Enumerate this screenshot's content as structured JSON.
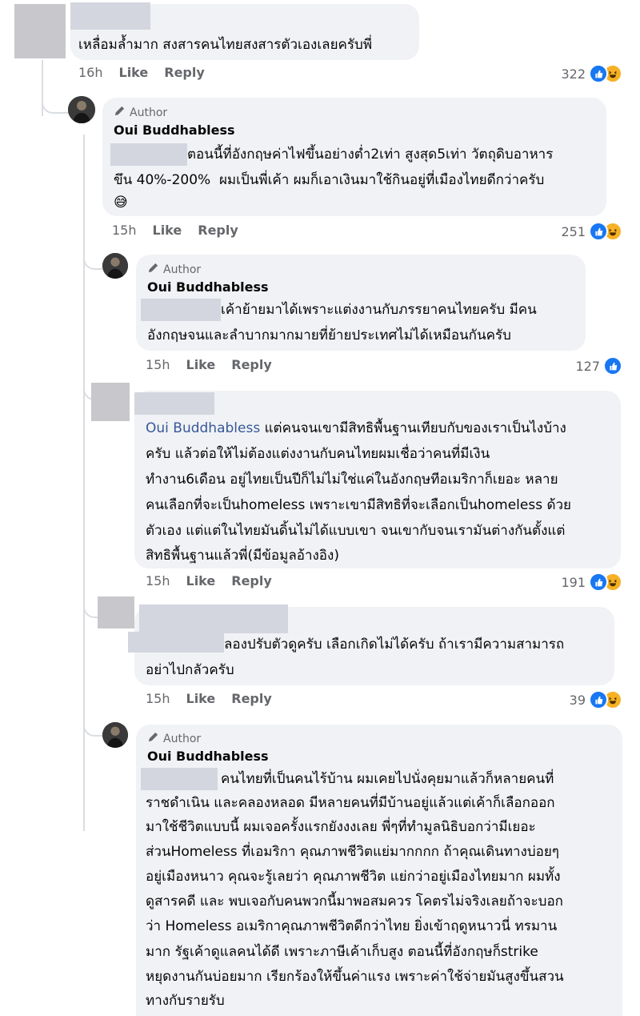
{
  "actions": {
    "like": "Like",
    "reply": "Reply"
  },
  "comments": [
    {
      "id": "c1",
      "text": [
        "เหลื่อมล้ำมาก สงสารคนไทยสงสารตัวเองเลยครับพี่"
      ],
      "time": "16h",
      "reactions": "322",
      "icons": [
        "like-icon",
        "haha-icon"
      ]
    },
    {
      "id": "c2",
      "badge": "Author",
      "name": "Oui Buddhabless",
      "text": [
        "ตอนนี้ที่อังกฤษค่าไฟขึ้นอย่างต่ำ2เท่า สูงสุด5เท่า วัตถุดิบอาหาร",
        "ขึน 40%-200%  ผมเป็นพี่เค้า ผมก็เอาเงินมาใช้กินอยู่ที่เมืองไทยดีกว่าครับ",
        "😅"
      ],
      "time": "15h",
      "reactions": "251",
      "icons": [
        "like-icon",
        "haha-icon"
      ]
    },
    {
      "id": "c3",
      "badge": "Author",
      "name": "Oui Buddhabless",
      "text": [
        "เค้าย้ายมาได้เพราะแต่งงานกับภรรยาคนไทยครับ มีคน",
        "อังกฤษจนและลำบากมากมายที่ย้ายประเทศไม่ได้เหมือนกันครับ"
      ],
      "time": "15h",
      "reactions": "127",
      "icons": [
        "like-icon"
      ]
    },
    {
      "id": "c4",
      "mention": "Oui Buddhabless",
      "text": [
        " แต่คนจนเขามีสิทธิพื้นฐานเทียบกับของเราเป็นไงบ้าง",
        "ครับ แล้วต่อให้ไม่ต้องแต่งงานกับคนไทยผมเชื่อว่าคนที่มีเงิน",
        "ทำงาน6เดือน อยู่ไทยเป็นปีก็ไม่ไม่ใช่แค่ในอังกฤษทีอเมริกาก็เยอะ หลาย",
        "คนเลือกที่จะเป็นhomeless เพราะเขามีสิทธิที่จะเลือกเป็นhomeless ด้วย",
        "ตัวเอง แต่แต่ในไทยมันดิ้นไม่ได้แบบเขา จนเขากับจนเรามันต่างกันตั้งแต่",
        "สิทธิพื้นฐานแล้วพี่(มีข้อมูลอ้างอิง)"
      ],
      "time": "15h",
      "reactions": "191",
      "icons": [
        "like-icon",
        "haha-icon"
      ]
    },
    {
      "id": "c5",
      "text": [
        "ลองปรับตัวดูครับ เลือกเกิดไม่ได้ครับ ถ้าเรามีความสามารถ",
        "อย่าไปกลัวครับ"
      ],
      "time": "15h",
      "reactions": "39",
      "icons": [
        "like-icon",
        "haha-icon"
      ]
    },
    {
      "id": "c6",
      "badge": "Author",
      "name": "Oui Buddhabless",
      "text": [
        "คนไทยที่เป็นคนไร้บ้าน ผมเคยไปนั่งคุยมาแล้วก็หลายคนที่",
        "ราชดำเนิน และคลองหลอด มีหลายคนที่มีบ้านอยู่แล้วแต่เค้าก็เลือกออก",
        "มาใช้ชีวิตแบบนี้ ผมเจอครั้งแรกยังงงเลย พี่ๆที่ทำมูลนิธิบอกว่ามีเยอะ",
        "ส่วนHomeless ที่เอมริกา คุณภาพชีวิตแย่มากกกก ถ้าคุณเดินทางบ่อยๆ",
        "อยู่เมืองหนาว คุณจะรู้เลยว่า คุณภาพชีวิต แย่กว่าอยู่เมืองไทยมาก ผมทั้ง",
        "ดูสารคดี และ พบเจอกับคนพวกนี้มาพอสมควร โคตรไม่จริงเลยถ้าจะบอก",
        "ว่า Homeless อเมริกาคุณภาพชีวิตดีกว่าไทย ยิ่งเข้าฤดูหนาวนี่ ทรมาน",
        "มาก รัฐเค้าดูแลคนได้ดี เพราะภาษีเค้าเก็บสูง ตอนนี้ที่อังกฤษก็strike",
        "หยุดงานกันบ่อยมาก เรียกร้องให้ขึ้นค่าแรง เพราะค่าใช้จ่ายมันสูงขึ้นสวน",
        "ทางกับรายรับ"
      ]
    }
  ],
  "colors": {
    "bubble": "#f0f2f5",
    "meta": "#65676b",
    "mention": "#385898",
    "like": "#1877f2",
    "haha": "#f7b125"
  }
}
